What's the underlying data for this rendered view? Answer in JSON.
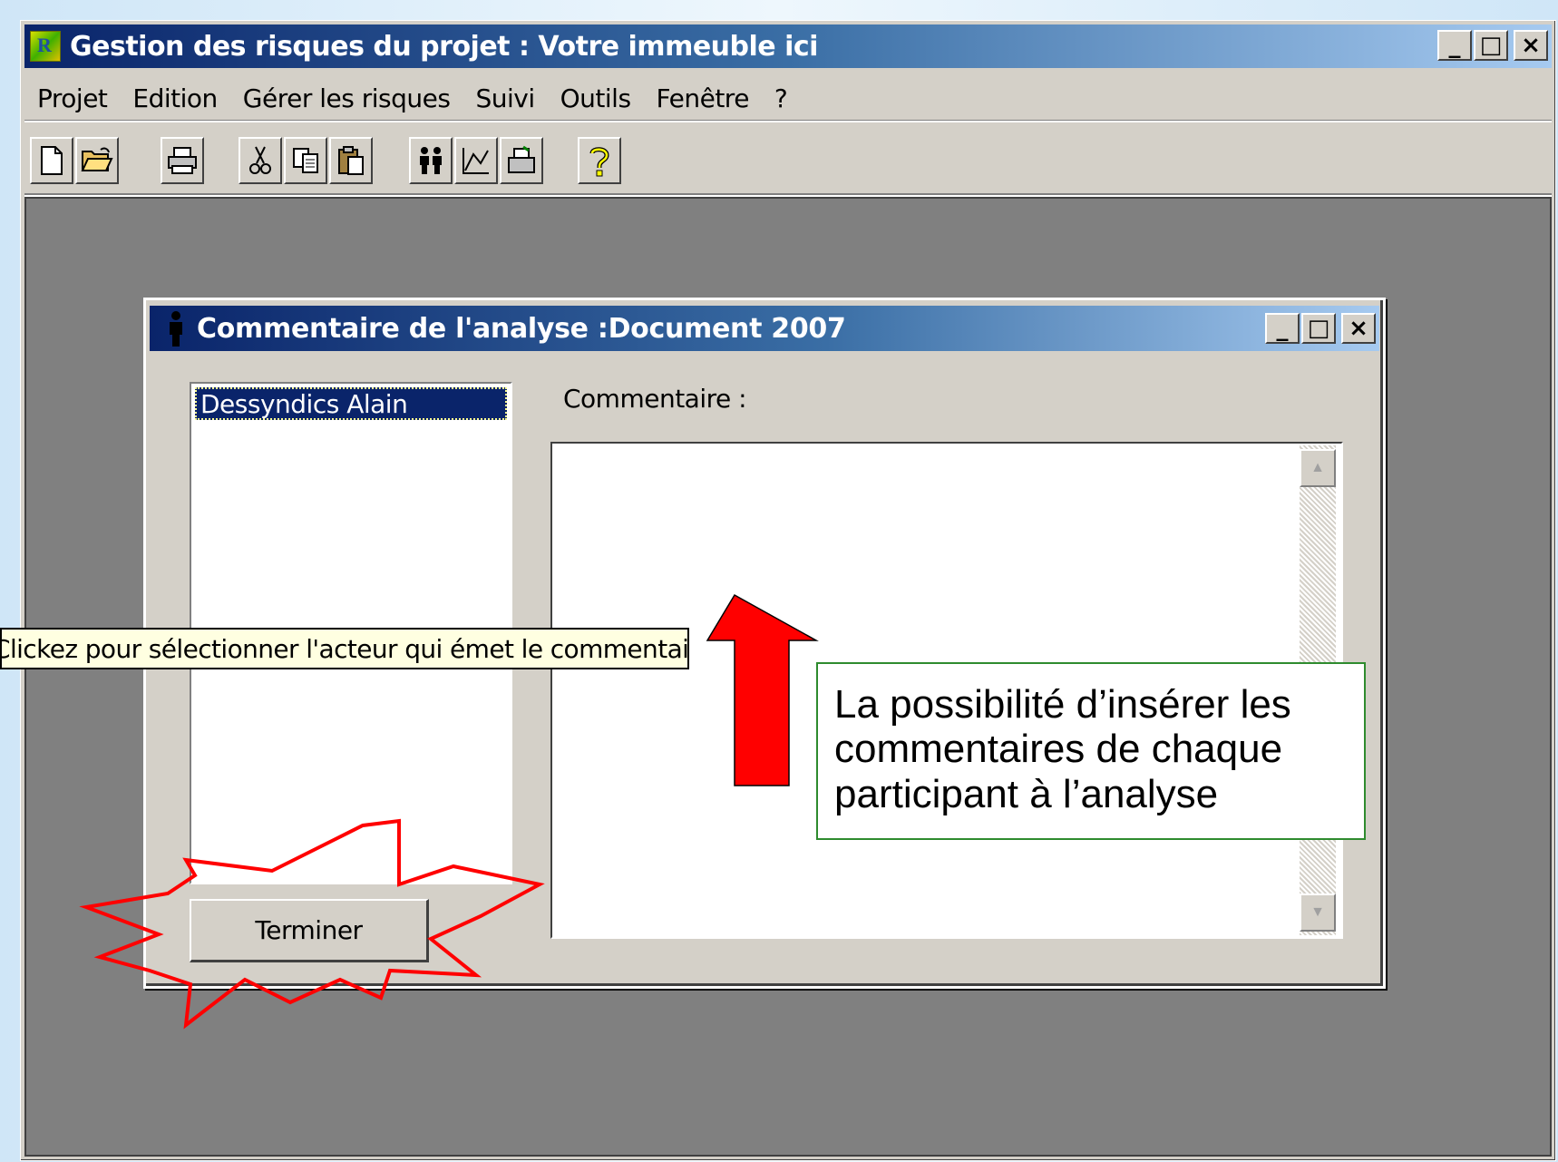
{
  "main_window": {
    "title": "Gestion des risques du projet : Votre immeuble ici",
    "controls": {
      "minimize": "_",
      "maximize": "□",
      "close": "×"
    }
  },
  "menu": [
    "Projet",
    "Edition",
    "Gérer les risques",
    "Suivi",
    "Outils",
    "Fenêtre",
    "?"
  ],
  "toolbar": {
    "icons": [
      "new-icon",
      "open-folder-icon",
      "print-icon",
      "cut-icon",
      "copy-icon",
      "paste-icon",
      "actors-icon",
      "chart-icon",
      "export-icon",
      "help-icon"
    ]
  },
  "dialog": {
    "title": "Commentaire de l'analyse :Document 2007",
    "controls": {
      "minimize": "_",
      "maximize": "□",
      "close": "×"
    },
    "actors": [
      "Dessyndics Alain"
    ],
    "comment_label": "Commentaire :",
    "comment_value": "",
    "finish_button": "Terminer"
  },
  "tooltip": "Clickez pour sélectionner l'acteur qui émet le commentaire",
  "annotation": {
    "text": "La possibilité d’insérer les commentaires de chaque participant à l’analyse",
    "arrow_color": "#ff0000",
    "burst_color": "#ff0000",
    "callout_border": "#2e8b2e"
  }
}
